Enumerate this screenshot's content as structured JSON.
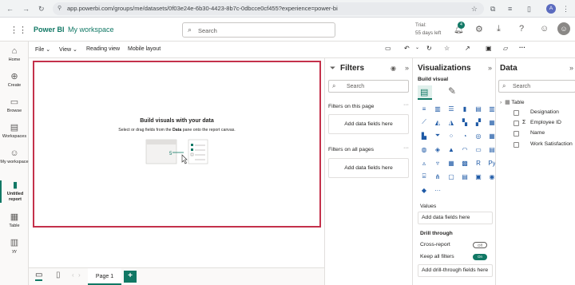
{
  "browser": {
    "url": "app.powerbi.com/groups/me/datasets/0f03e24e-6b30-4423-8b7c-0dbcce0cf455?experience=power-bi",
    "avatar_letter": "A"
  },
  "header": {
    "brand": "Power BI",
    "workspace": "My workspace",
    "search_placeholder": "Search",
    "trial_label": "Trial:",
    "trial_days": "55 days left",
    "notification_count": "4"
  },
  "nav": [
    {
      "label": "Home",
      "icon": "home-icon"
    },
    {
      "label": "Create",
      "icon": "plus-circle-icon"
    },
    {
      "label": "Browse",
      "icon": "folder-icon"
    },
    {
      "label": "Workspaces",
      "icon": "workspaces-icon"
    },
    {
      "label": "My workspace",
      "icon": "my-workspace-icon"
    },
    {
      "label": "Untitled report",
      "icon": "report-icon"
    },
    {
      "label": "Table",
      "icon": "table-icon"
    },
    {
      "label": "yy",
      "icon": "dataset-icon"
    }
  ],
  "toolbar": {
    "file": "File",
    "view": "View",
    "reading_view": "Reading view",
    "mobile_layout": "Mobile layout"
  },
  "canvas": {
    "title": "Build visuals with your data",
    "subtitle_pre": "Select or drag fields from the ",
    "subtitle_bold": "Data",
    "subtitle_post": " pane onto the report canvas.",
    "illustration_number": "5"
  },
  "filters": {
    "title": "Filters",
    "search_placeholder": "Search",
    "on_this_page": "Filters on this page",
    "on_all_pages": "Filters on all pages",
    "add_fields": "Add data fields here"
  },
  "visualizations": {
    "title": "Visualizations",
    "build_visual": "Build visual",
    "values": "Values",
    "add_fields": "Add data fields here",
    "drill_through": "Drill through",
    "cross_report": "Cross-report",
    "cross_report_state": "Off",
    "keep_filters": "Keep all filters",
    "keep_filters_state": "On",
    "add_drill": "Add drill-through fields here",
    "more": "..."
  },
  "data": {
    "title": "Data",
    "search_placeholder": "Search",
    "table_name": "Table",
    "fields": [
      {
        "name": "Designation",
        "sigma": false
      },
      {
        "name": "Employee ID",
        "sigma": true
      },
      {
        "name": "Name",
        "sigma": false
      },
      {
        "name": "Work Satisfaction",
        "sigma": false
      }
    ]
  },
  "pages": {
    "page1": "Page 1",
    "add": "+"
  },
  "colors": {
    "brand": "#c19c00",
    "accent": "#117865",
    "canvas_border": "#c4314b",
    "viz_blue": "#1f5aa6"
  }
}
